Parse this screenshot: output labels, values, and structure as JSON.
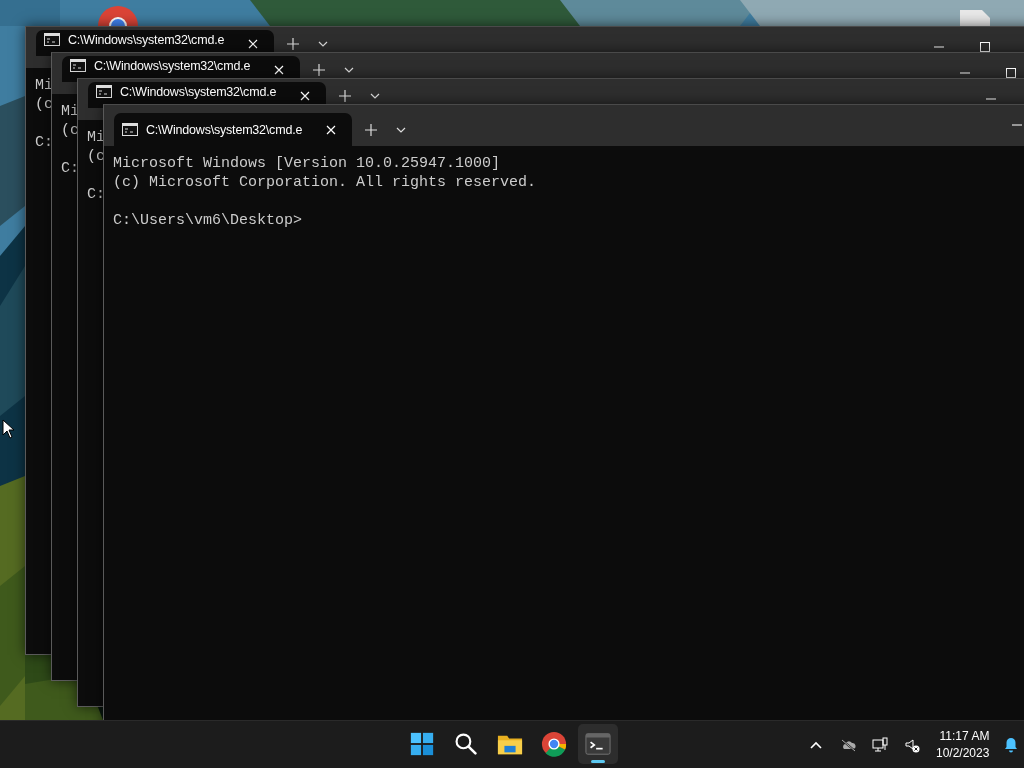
{
  "windows": [
    {
      "active": false,
      "tab_title": "C:\\Windows\\system32\\cmd.e",
      "banner": [
        "Mi",
        "(c"
      ],
      "prompt": "C:",
      "caption_buttons": [
        {
          "kind": "minimize"
        },
        {
          "kind": "maximize"
        }
      ]
    },
    {
      "active": false,
      "tab_title": "C:\\Windows\\system32\\cmd.e",
      "banner": [
        "Mi",
        "(c"
      ],
      "prompt": "C:",
      "caption_buttons": [
        {
          "kind": "minimize"
        },
        {
          "kind": "maximize"
        }
      ]
    },
    {
      "active": false,
      "tab_title": "C:\\Windows\\system32\\cmd.e",
      "banner": [
        "Mi",
        "(c"
      ],
      "prompt": "C:",
      "caption_buttons": [
        {
          "kind": "minimize"
        }
      ]
    },
    {
      "active": true,
      "tab_title": "C:\\Windows\\system32\\cmd.e",
      "banner": [
        "Microsoft Windows [Version 10.0.25947.1000]",
        "(c) Microsoft Corporation. All rights reserved."
      ],
      "prompt": "C:\\Users\\vm6\\Desktop>",
      "caption_buttons": [
        {
          "kind": "minimize"
        }
      ]
    }
  ],
  "taskbar": {
    "apps": [
      {
        "kind": "start",
        "running": false
      },
      {
        "kind": "search",
        "running": false
      },
      {
        "kind": "explorer",
        "running": false
      },
      {
        "kind": "browser",
        "running": false
      },
      {
        "kind": "terminal",
        "running": true
      }
    ],
    "tray": {
      "icons": [
        {
          "kind": "chevron"
        },
        {
          "kind": "cloud-off"
        },
        {
          "kind": "network"
        },
        {
          "kind": "volume-muted"
        }
      ],
      "time": "11:17 AM",
      "date": "10/2/2023"
    }
  }
}
